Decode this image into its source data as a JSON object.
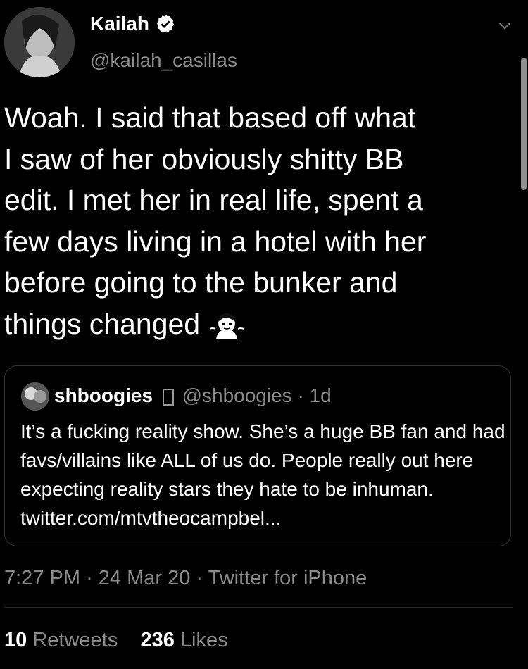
{
  "author": {
    "name": "Kailah",
    "handle": "@kailah_casillas"
  },
  "tweet": {
    "text": "Woah. I said that based off what\nI saw of her obviously shitty BB\nedit. I met her in real life, spent a\nfew days living in a hotel with her\nbefore going to the bunker and\nthings changed "
  },
  "quoted": {
    "name": "shboogies",
    "handle": "@shboogies",
    "age": "· 1d",
    "text": "It’s a fucking reality show. She’s a huge BB fan and had favs/villains like ALL of us do. People really out here expecting reality stars they hate to be inhuman. twitter.com/mtvtheocampbel..."
  },
  "meta": {
    "time": "7:27 PM",
    "date": "24 Mar 20",
    "source": "Twitter for iPhone"
  },
  "stats": {
    "retweets": "10",
    "retweets_label": "Retweets",
    "likes": "236",
    "likes_label": "Likes"
  }
}
